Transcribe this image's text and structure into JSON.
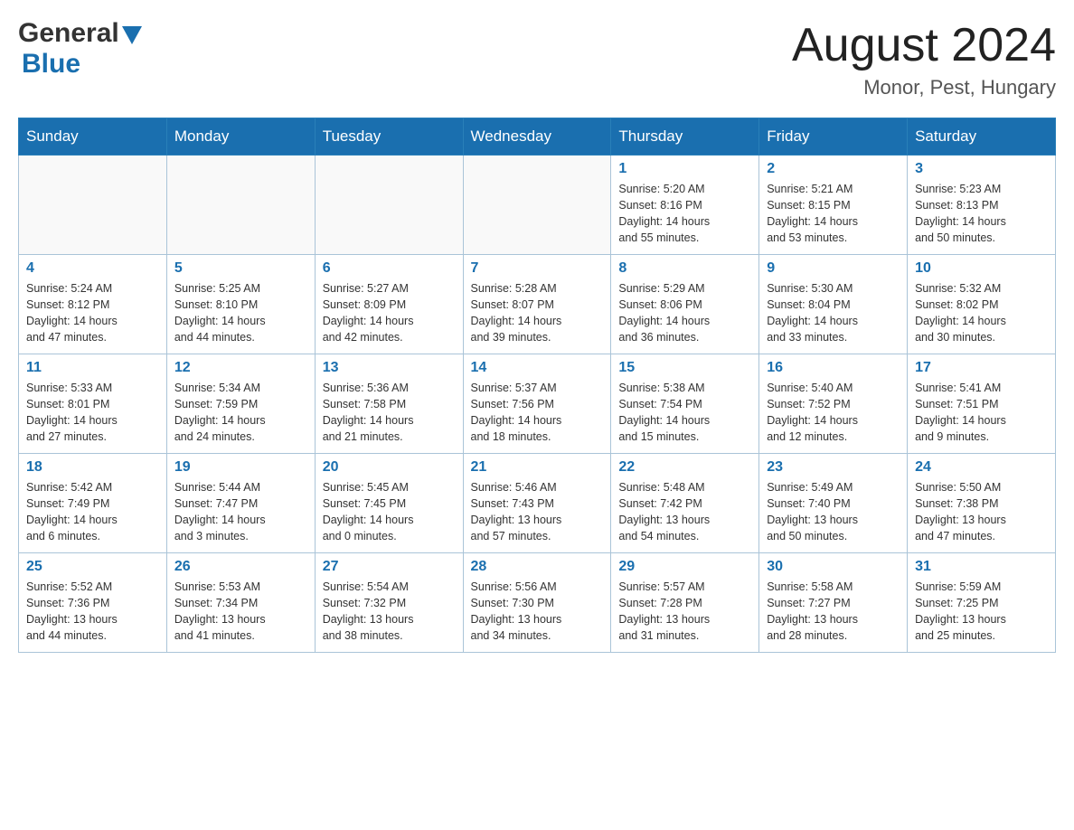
{
  "header": {
    "logo_general": "General",
    "logo_blue": "Blue",
    "month_title": "August 2024",
    "location": "Monor, Pest, Hungary"
  },
  "days_of_week": [
    "Sunday",
    "Monday",
    "Tuesday",
    "Wednesday",
    "Thursday",
    "Friday",
    "Saturday"
  ],
  "weeks": [
    {
      "cells": [
        {
          "day": "",
          "info": ""
        },
        {
          "day": "",
          "info": ""
        },
        {
          "day": "",
          "info": ""
        },
        {
          "day": "",
          "info": ""
        },
        {
          "day": "1",
          "info": "Sunrise: 5:20 AM\nSunset: 8:16 PM\nDaylight: 14 hours\nand 55 minutes."
        },
        {
          "day": "2",
          "info": "Sunrise: 5:21 AM\nSunset: 8:15 PM\nDaylight: 14 hours\nand 53 minutes."
        },
        {
          "day": "3",
          "info": "Sunrise: 5:23 AM\nSunset: 8:13 PM\nDaylight: 14 hours\nand 50 minutes."
        }
      ]
    },
    {
      "cells": [
        {
          "day": "4",
          "info": "Sunrise: 5:24 AM\nSunset: 8:12 PM\nDaylight: 14 hours\nand 47 minutes."
        },
        {
          "day": "5",
          "info": "Sunrise: 5:25 AM\nSunset: 8:10 PM\nDaylight: 14 hours\nand 44 minutes."
        },
        {
          "day": "6",
          "info": "Sunrise: 5:27 AM\nSunset: 8:09 PM\nDaylight: 14 hours\nand 42 minutes."
        },
        {
          "day": "7",
          "info": "Sunrise: 5:28 AM\nSunset: 8:07 PM\nDaylight: 14 hours\nand 39 minutes."
        },
        {
          "day": "8",
          "info": "Sunrise: 5:29 AM\nSunset: 8:06 PM\nDaylight: 14 hours\nand 36 minutes."
        },
        {
          "day": "9",
          "info": "Sunrise: 5:30 AM\nSunset: 8:04 PM\nDaylight: 14 hours\nand 33 minutes."
        },
        {
          "day": "10",
          "info": "Sunrise: 5:32 AM\nSunset: 8:02 PM\nDaylight: 14 hours\nand 30 minutes."
        }
      ]
    },
    {
      "cells": [
        {
          "day": "11",
          "info": "Sunrise: 5:33 AM\nSunset: 8:01 PM\nDaylight: 14 hours\nand 27 minutes."
        },
        {
          "day": "12",
          "info": "Sunrise: 5:34 AM\nSunset: 7:59 PM\nDaylight: 14 hours\nand 24 minutes."
        },
        {
          "day": "13",
          "info": "Sunrise: 5:36 AM\nSunset: 7:58 PM\nDaylight: 14 hours\nand 21 minutes."
        },
        {
          "day": "14",
          "info": "Sunrise: 5:37 AM\nSunset: 7:56 PM\nDaylight: 14 hours\nand 18 minutes."
        },
        {
          "day": "15",
          "info": "Sunrise: 5:38 AM\nSunset: 7:54 PM\nDaylight: 14 hours\nand 15 minutes."
        },
        {
          "day": "16",
          "info": "Sunrise: 5:40 AM\nSunset: 7:52 PM\nDaylight: 14 hours\nand 12 minutes."
        },
        {
          "day": "17",
          "info": "Sunrise: 5:41 AM\nSunset: 7:51 PM\nDaylight: 14 hours\nand 9 minutes."
        }
      ]
    },
    {
      "cells": [
        {
          "day": "18",
          "info": "Sunrise: 5:42 AM\nSunset: 7:49 PM\nDaylight: 14 hours\nand 6 minutes."
        },
        {
          "day": "19",
          "info": "Sunrise: 5:44 AM\nSunset: 7:47 PM\nDaylight: 14 hours\nand 3 minutes."
        },
        {
          "day": "20",
          "info": "Sunrise: 5:45 AM\nSunset: 7:45 PM\nDaylight: 14 hours\nand 0 minutes."
        },
        {
          "day": "21",
          "info": "Sunrise: 5:46 AM\nSunset: 7:43 PM\nDaylight: 13 hours\nand 57 minutes."
        },
        {
          "day": "22",
          "info": "Sunrise: 5:48 AM\nSunset: 7:42 PM\nDaylight: 13 hours\nand 54 minutes."
        },
        {
          "day": "23",
          "info": "Sunrise: 5:49 AM\nSunset: 7:40 PM\nDaylight: 13 hours\nand 50 minutes."
        },
        {
          "day": "24",
          "info": "Sunrise: 5:50 AM\nSunset: 7:38 PM\nDaylight: 13 hours\nand 47 minutes."
        }
      ]
    },
    {
      "cells": [
        {
          "day": "25",
          "info": "Sunrise: 5:52 AM\nSunset: 7:36 PM\nDaylight: 13 hours\nand 44 minutes."
        },
        {
          "day": "26",
          "info": "Sunrise: 5:53 AM\nSunset: 7:34 PM\nDaylight: 13 hours\nand 41 minutes."
        },
        {
          "day": "27",
          "info": "Sunrise: 5:54 AM\nSunset: 7:32 PM\nDaylight: 13 hours\nand 38 minutes."
        },
        {
          "day": "28",
          "info": "Sunrise: 5:56 AM\nSunset: 7:30 PM\nDaylight: 13 hours\nand 34 minutes."
        },
        {
          "day": "29",
          "info": "Sunrise: 5:57 AM\nSunset: 7:28 PM\nDaylight: 13 hours\nand 31 minutes."
        },
        {
          "day": "30",
          "info": "Sunrise: 5:58 AM\nSunset: 7:27 PM\nDaylight: 13 hours\nand 28 minutes."
        },
        {
          "day": "31",
          "info": "Sunrise: 5:59 AM\nSunset: 7:25 PM\nDaylight: 13 hours\nand 25 minutes."
        }
      ]
    }
  ]
}
